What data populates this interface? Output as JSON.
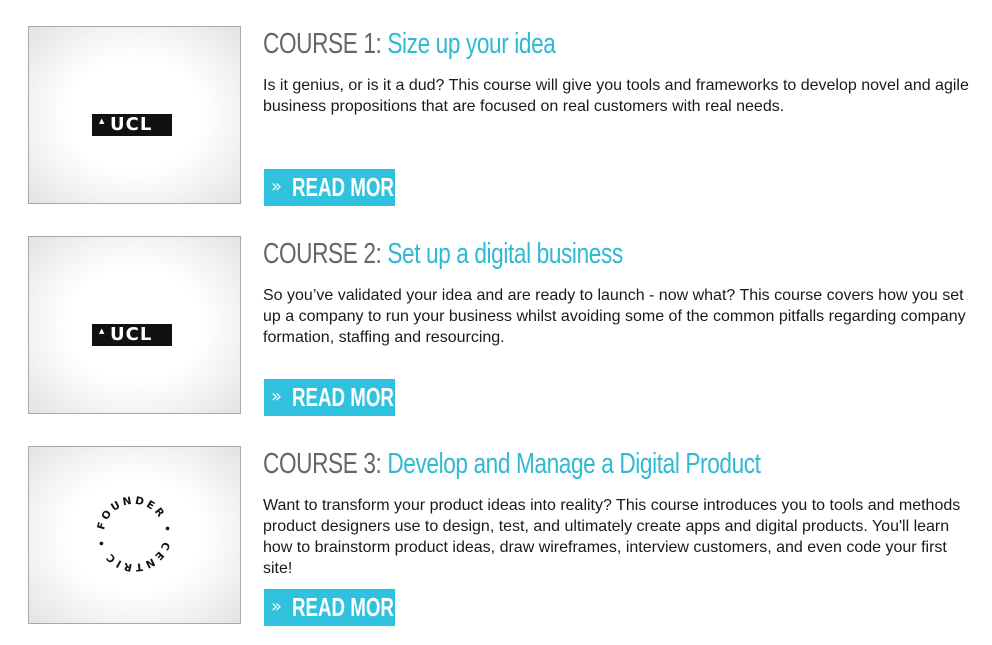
{
  "courses": [
    {
      "label": "COURSE 1",
      "colon": ":",
      "title": "Size up your idea",
      "description": "Is it genius, or is it a dud? This course will give you tools and frameworks to develop novel and agile business propositions that are focused on real customers with real needs.",
      "logo": "ucl-logo",
      "logo_text": "UCL",
      "button": {
        "icon": "double-chevron-right-icon",
        "label": "READ MORE"
      }
    },
    {
      "label": "COURSE 2",
      "colon": ":",
      "title": "Set up a digital business",
      "description": "So you’ve validated your idea and are ready to launch - now what? This course covers how you set up a company to run your business whilst avoiding some of the common pitfalls regarding company formation, staffing and resourcing.",
      "logo": "ucl-logo",
      "logo_text": "UCL",
      "button": {
        "icon": "double-chevron-right-icon",
        "label": "READ MORE"
      }
    },
    {
      "label": "COURSE 3",
      "colon": ":",
      "title": "Develop and Manage a Digital Product",
      "description": "Want to transform your product ideas into reality? This course introduces you to tools and methods product designers use to design, test, and ultimately create apps and digital products. You'll learn how to brainstorm product ideas, draw wireframes, interview customers, and even code your first site!",
      "logo": "founder-centric-logo",
      "logo_text": "FOUNDER CENTRIC",
      "button": {
        "icon": "double-chevron-right-icon",
        "label": "READ MORE"
      }
    }
  ],
  "colors": {
    "accent": "#2fc1dd",
    "title_blue": "#2fb9d4",
    "heading_gray": "#666666"
  }
}
